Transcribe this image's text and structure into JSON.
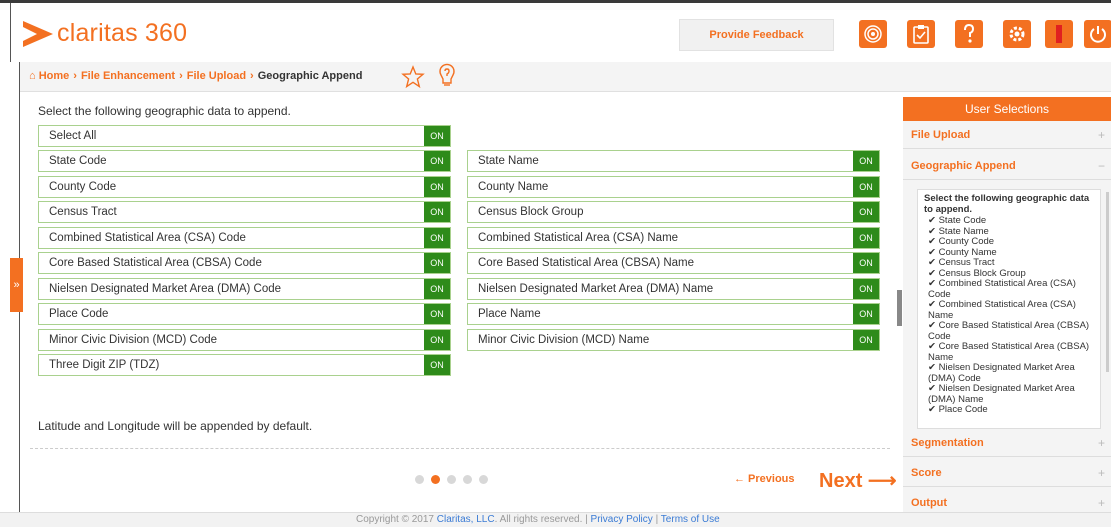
{
  "colors": {
    "brand": "#f37021",
    "switch_on": "#2e8b1a",
    "row_border": "#a9d18e"
  },
  "header": {
    "logo": "claritas 360",
    "feedback_label": "Provide Feedback",
    "icons": [
      "target-icon",
      "clipboard-icon",
      "help-icon",
      "gear-icon",
      "alert-icon",
      "power-icon"
    ]
  },
  "breadcrumb": {
    "home": "Home",
    "sep": "›",
    "items": [
      "File Enhancement",
      "File Upload"
    ],
    "current": "Geographic Append"
  },
  "main": {
    "intro": "Select the following geographic data to append.",
    "switch_label": "ON",
    "select_all": "Select All",
    "left_col": [
      "State Code",
      "County Code",
      "Census Tract",
      "Combined Statistical Area (CSA) Code",
      "Core Based Statistical Area (CBSA) Code",
      "Nielsen Designated Market Area (DMA) Code",
      "Place Code",
      "Minor Civic Division (MCD) Code",
      "Three Digit ZIP (TDZ)"
    ],
    "right_col": [
      "State Name",
      "County Name",
      "Census Block Group",
      "Combined Statistical Area (CSA) Name",
      "Core Based Statistical Area (CBSA) Name",
      "Nielsen Designated Market Area (DMA) Name",
      "Place Name",
      "Minor Civic Division (MCD) Name"
    ],
    "note": "Latitude and Longitude will be appended by default."
  },
  "user_selections": {
    "title": "User Selections",
    "sections": [
      "File Upload",
      "Geographic Append",
      "Segmentation",
      "Score",
      "Output"
    ],
    "box_head": "Select the following geographic data to append.",
    "items": [
      "✔ State Code",
      "✔ State Name",
      "✔ County Code",
      "✔ County Name",
      "✔ Census Tract",
      "✔ Census Block Group",
      "✔ Combined Statistical Area (CSA) Code",
      "✔ Combined Statistical Area (CSA) Name",
      "✔ Core Based Statistical Area (CBSA) Code",
      "✔ Core Based Statistical Area (CBSA) Name",
      "✔ Nielsen Designated Market Area (DMA) Code",
      "✔ Nielsen Designated Market Area (DMA) Name",
      "✔ Place Code"
    ]
  },
  "nav": {
    "prev": "← Previous",
    "next": "Next ⟶",
    "step_active": 2,
    "step_total": 5
  },
  "footer": {
    "copyright": "Copyright © 2017",
    "company": "Claritas, LLC",
    "rights": ". All rights reserved. |",
    "privacy": "Privacy Policy",
    "bar": "|",
    "terms": "Terms of Use"
  }
}
